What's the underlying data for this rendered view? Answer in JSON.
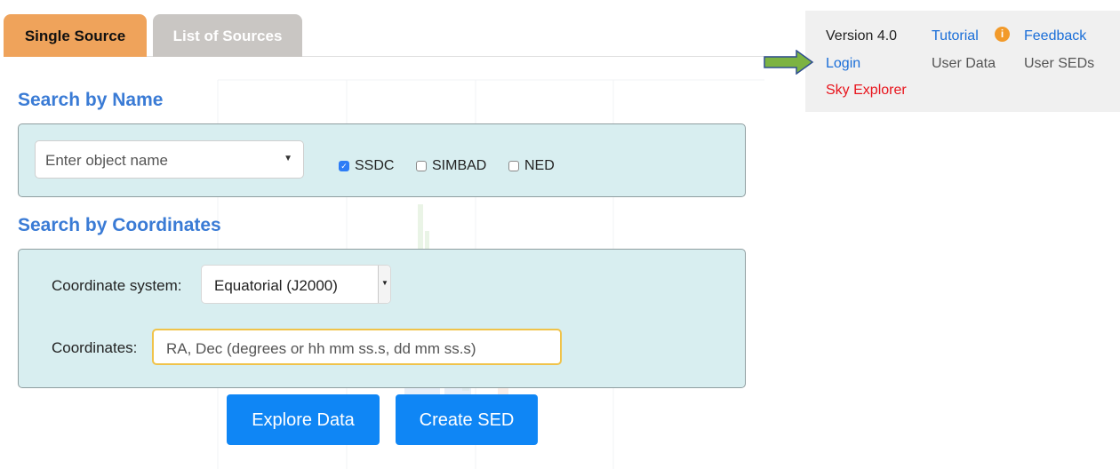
{
  "tabs": [
    {
      "label": "Single Source",
      "active": true
    },
    {
      "label": "List of Sources",
      "active": false
    }
  ],
  "search_by_name": {
    "title": "Search by Name",
    "placeholder": "Enter object name",
    "catalogs": [
      {
        "label": "SSDC",
        "checked": true
      },
      {
        "label": "SIMBAD",
        "checked": false
      },
      {
        "label": "NED",
        "checked": false
      }
    ]
  },
  "search_by_coordinates": {
    "title": "Search by Coordinates",
    "system_label": "Coordinate system:",
    "system_value": "Equatorial (J2000)",
    "coordinates_label": "Coordinates:",
    "coordinates_placeholder": "RA, Dec (degrees or hh mm ss.s, dd mm ss.s)"
  },
  "buttons": {
    "explore": "Explore Data",
    "create_sed": "Create SED"
  },
  "side_panel": {
    "version": "Version 4.0",
    "tutorial": "Tutorial",
    "feedback": "Feedback",
    "login": "Login",
    "user_data": "User Data",
    "user_seds": "User SEDs",
    "sky_explorer": "Sky Explorer"
  },
  "colors": {
    "active_tab": "#efa35b",
    "inactive_tab": "#c9c6c3",
    "panel_bg": "#d8eef0",
    "title_blue": "#3a7bd5",
    "button_blue": "#0f86f5",
    "link_blue": "#1a6ed8",
    "sky_explorer_red": "#e8141c",
    "annotation_arrow_green": "#7cb342"
  },
  "icons": {
    "info": "info-icon",
    "annotation": "green-arrow-icon"
  }
}
